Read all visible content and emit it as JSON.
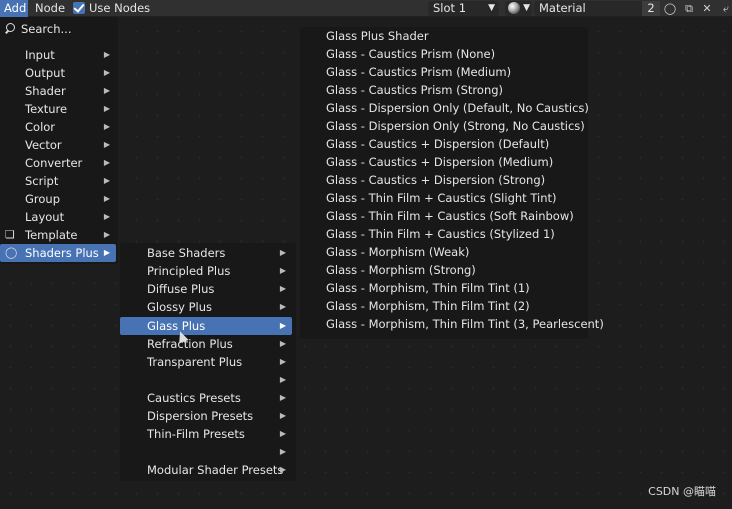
{
  "header": {
    "add_label": "Add",
    "node_label": "Node",
    "use_nodes_label": "Use Nodes",
    "slot_value": "Slot 1",
    "material_name": "Material",
    "material_users": "2"
  },
  "add_menu": {
    "search_label": "Search...",
    "items": [
      {
        "label": "Input"
      },
      {
        "label": "Output"
      },
      {
        "label": "Shader"
      },
      {
        "label": "Texture"
      },
      {
        "label": "Color"
      },
      {
        "label": "Vector"
      },
      {
        "label": "Converter"
      },
      {
        "label": "Script"
      },
      {
        "label": "Group"
      },
      {
        "label": "Layout"
      },
      {
        "label": "Template"
      },
      {
        "label": "Shaders Plus"
      }
    ]
  },
  "shaders_plus_menu": {
    "items": [
      {
        "label": "Base Shaders"
      },
      {
        "label": "Principled Plus"
      },
      {
        "label": "Diffuse Plus"
      },
      {
        "label": "Glossy Plus"
      },
      {
        "label": "Glass Plus"
      },
      {
        "label": "Refraction Plus"
      },
      {
        "label": "Transparent Plus"
      },
      {
        "label": ""
      },
      {
        "label": "Caustics Presets"
      },
      {
        "label": "Dispersion Presets"
      },
      {
        "label": "Thin-Film Presets"
      },
      {
        "label": ""
      },
      {
        "label": "Modular Shader Presets"
      }
    ]
  },
  "glass_plus_menu": {
    "items": [
      {
        "label": "Glass Plus Shader"
      },
      {
        "label": "Glass - Caustics Prism (None)"
      },
      {
        "label": "Glass - Caustics Prism (Medium)"
      },
      {
        "label": "Glass - Caustics Prism (Strong)"
      },
      {
        "label": "Glass - Dispersion Only (Default, No Caustics)"
      },
      {
        "label": "Glass - Dispersion Only (Strong, No Caustics)"
      },
      {
        "label": "Glass - Caustics + Dispersion (Default)"
      },
      {
        "label": "Glass - Caustics + Dispersion (Medium)"
      },
      {
        "label": "Glass - Caustics + Dispersion (Strong)"
      },
      {
        "label": "Glass - Thin Film + Caustics (Slight Tint)"
      },
      {
        "label": "Glass - Thin Film + Caustics (Soft Rainbow)"
      },
      {
        "label": "Glass - Thin Film + Caustics (Stylized 1)"
      },
      {
        "label": "Glass - Morphism (Weak)"
      },
      {
        "label": "Glass - Morphism (Strong)"
      },
      {
        "label": "Glass - Morphism, Thin Film Tint (1)"
      },
      {
        "label": "Glass - Morphism, Thin Film Tint (2)"
      },
      {
        "label": "Glass - Morphism, Thin Film Tint (3, Pearlescent)"
      }
    ]
  },
  "watermark": "CSDN @瞄喵",
  "colors": {
    "accent": "#4772b3",
    "menu_bg": "#181818",
    "editor_bg": "#1d1d1d",
    "header_bg": "#303030"
  },
  "icons": {
    "search": "search-icon",
    "template": "template-icon",
    "shaders_plus": "shaders-plus-icon",
    "material_sphere": "material-sphere-icon",
    "fake_user": "shield-icon",
    "duplicate": "duplicate-icon",
    "unlink": "close-icon",
    "pin": "pin-icon"
  }
}
